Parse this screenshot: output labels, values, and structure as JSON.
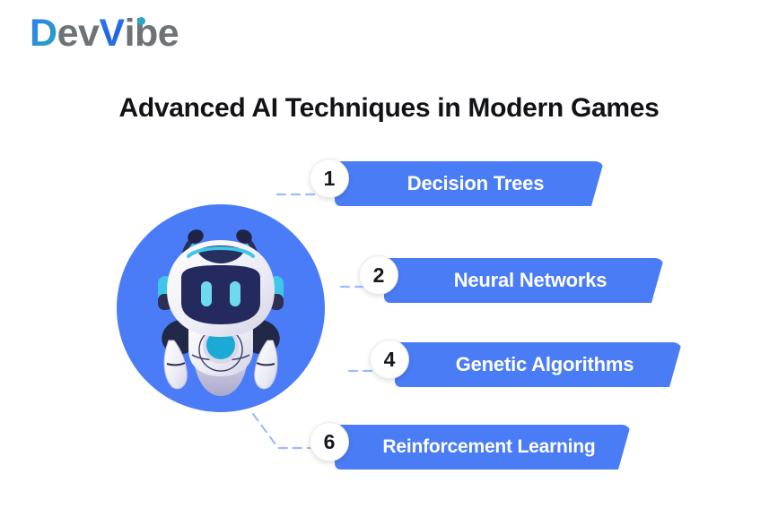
{
  "brand": {
    "logo_part1": "D",
    "logo_part2": "ev",
    "logo_part3": "V",
    "logo_part4": "ibe",
    "full_name": "DevVibe"
  },
  "header": {
    "title": "Advanced AI Techniques in Modern Games"
  },
  "illustration": {
    "name": "ai-robot-mascot",
    "circle_color": "#4b7cf8",
    "robot_body_color": "#f2f2f8",
    "robot_visor_color": "#252a5e",
    "robot_accent_color": "#2ab3d6"
  },
  "items": [
    {
      "number": "1",
      "label": "Decision Trees"
    },
    {
      "number": "2",
      "label": "Neural Networks"
    },
    {
      "number": "4",
      "label": "Genetic Algorithms"
    },
    {
      "number": "6",
      "label": "Reinforcement Learning"
    }
  ],
  "colors": {
    "banner_blue": "#4a7cf6",
    "badge_bg": "#ffffff",
    "badge_text": "#16181c",
    "title_text": "#111317",
    "connector_line": "#9dbdf7",
    "background": "#ffffff"
  }
}
